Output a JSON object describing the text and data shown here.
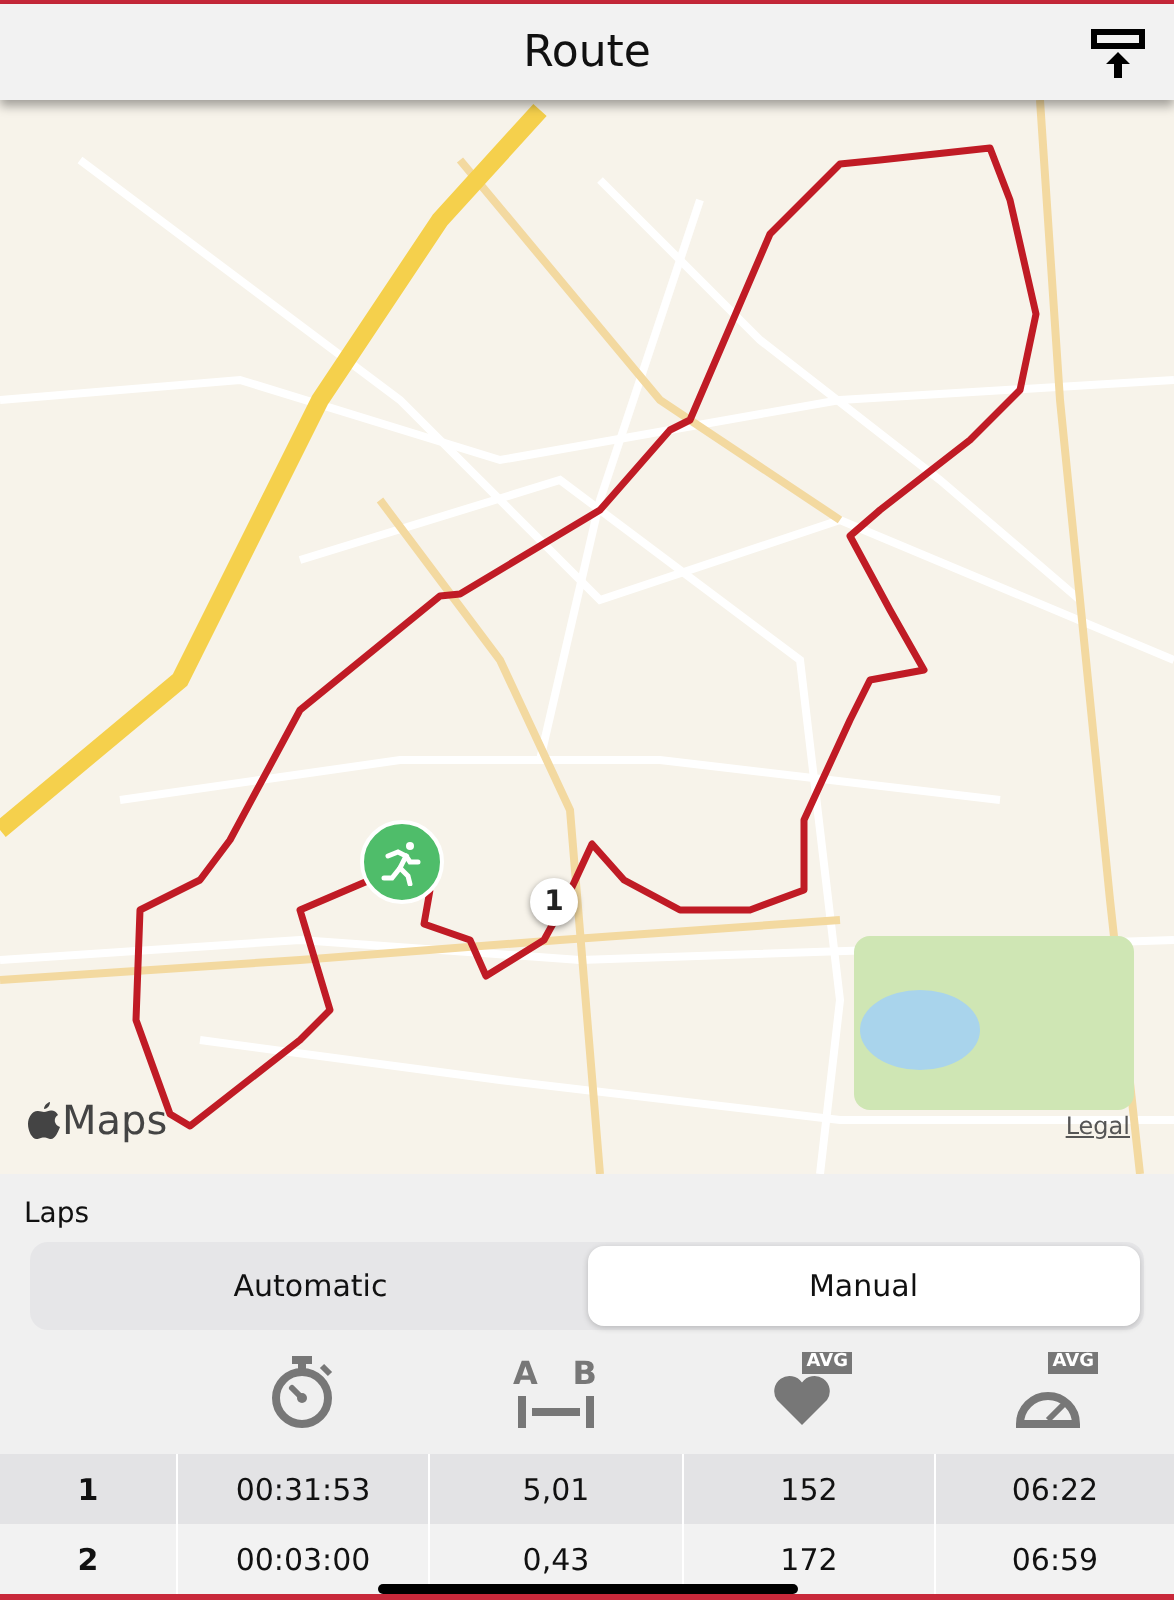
{
  "header": {
    "title": "Route"
  },
  "map": {
    "lap_marker": "1",
    "logo": "Maps",
    "legal": "Legal"
  },
  "laps": {
    "title": "Laps",
    "segments": [
      {
        "label": "Automatic",
        "selected": false
      },
      {
        "label": "Manual",
        "selected": true
      }
    ],
    "columns": [
      {
        "kind": "time"
      },
      {
        "kind": "distance",
        "from": "A",
        "to": "B"
      },
      {
        "kind": "heart_rate",
        "badge": "AVG"
      },
      {
        "kind": "pace",
        "badge": "AVG"
      }
    ],
    "rows": [
      {
        "lap": "1",
        "time": "00:31:53",
        "distance": "5,01",
        "heart_rate": "152",
        "pace": "06:22"
      },
      {
        "lap": "2",
        "time": "00:03:00",
        "distance": "0,43",
        "heart_rate": "172",
        "pace": "06:59"
      }
    ]
  }
}
